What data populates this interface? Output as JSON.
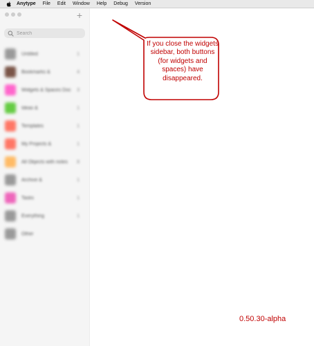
{
  "menubar": {
    "app_name": "Anytype",
    "items": [
      "File",
      "Edit",
      "Window",
      "Help",
      "Debug",
      "Version"
    ]
  },
  "sidebar": {
    "add_label": "+",
    "search": {
      "placeholder": "Search"
    },
    "items": [
      {
        "label": "Untitled",
        "count": "1",
        "color": "#9a9a9a"
      },
      {
        "label": "Bookmarks &",
        "count": "4",
        "color": "#7a5548"
      },
      {
        "label": "Widgets & Spaces Doc",
        "count": "3",
        "color": "#ff66cc"
      },
      {
        "label": "Ideas &",
        "count": "1",
        "color": "#66cc44"
      },
      {
        "label": "Templates",
        "count": "1",
        "color": "#ff7766"
      },
      {
        "label": "My Projects &",
        "count": "1",
        "color": "#ff7766"
      },
      {
        "label": "All Objects with notes",
        "count": "8",
        "color": "#ffbb66"
      },
      {
        "label": "Archive &",
        "count": "1",
        "color": "#9a9a9a"
      },
      {
        "label": "Tasks",
        "count": "1",
        "color": "#ee66bb"
      },
      {
        "label": "Everything",
        "count": "1",
        "color": "#9a9a9a"
      },
      {
        "label": "Other",
        "count": "",
        "color": "#9a9a9a"
      }
    ]
  },
  "annotation": {
    "callout_text": "If you close the widgets sidebar, both buttons (for widgets and spaces) have disappeared.",
    "version": "0.50.30-alpha",
    "color": "#c00000"
  }
}
